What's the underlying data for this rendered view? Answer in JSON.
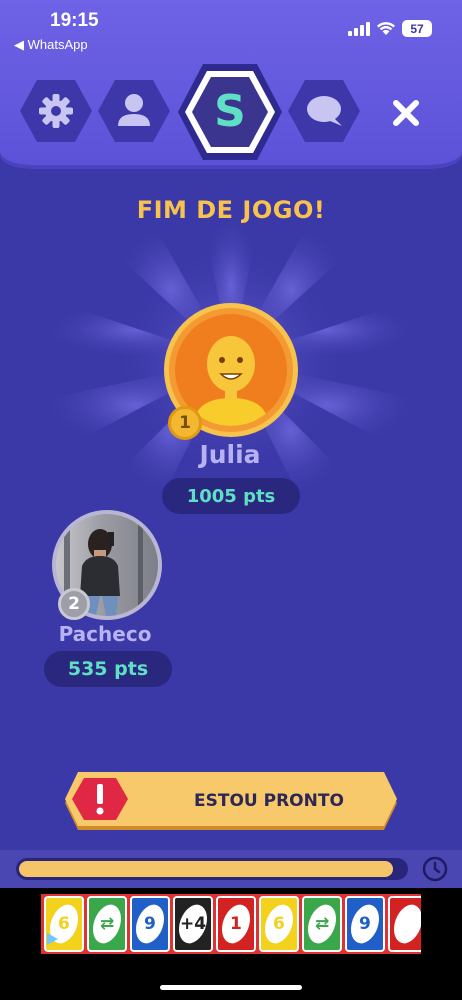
{
  "status_bar": {
    "time": "19:15",
    "back_label": "◀ WhatsApp",
    "battery": "57"
  },
  "header": {
    "tabs": [
      {
        "name": "settings",
        "icon": "gear-icon"
      },
      {
        "name": "profile",
        "icon": "user-icon"
      },
      {
        "name": "game",
        "icon": "s-logo",
        "label": "S",
        "active": true
      },
      {
        "name": "chat",
        "icon": "chat-bubble-icon"
      }
    ],
    "close_icon": "close-icon"
  },
  "game_over": {
    "title": "FIM DE JOGO!"
  },
  "players": [
    {
      "rank": "1",
      "name": "Julia",
      "points": "1005 pts"
    },
    {
      "rank": "2",
      "name": "Pacheco",
      "points": "535 pts"
    }
  ],
  "ready_button": {
    "label": "ESTOU PRONTO",
    "icon": "alert-icon"
  },
  "timer": {
    "progress": 0.97,
    "icon": "clock-icon"
  },
  "ad": {
    "cards": [
      {
        "color": "#f2d21c",
        "value": "6"
      },
      {
        "color": "#3aa84a",
        "value": "⇄"
      },
      {
        "color": "#1f5fc7",
        "value": "9"
      },
      {
        "color": "#222222",
        "value": "+4"
      },
      {
        "color": "#d32222",
        "value": "1"
      },
      {
        "color": "#f2d21c",
        "value": "6"
      },
      {
        "color": "#3aa84a",
        "value": "⇄"
      },
      {
        "color": "#1f5fc7",
        "value": "9"
      },
      {
        "color": "#d32222",
        "value": ""
      }
    ]
  },
  "colors": {
    "background": "#3b38a8",
    "header": "#6e63e6",
    "accent_gold": "#f7c34c",
    "points_text": "#5fe0c5"
  }
}
